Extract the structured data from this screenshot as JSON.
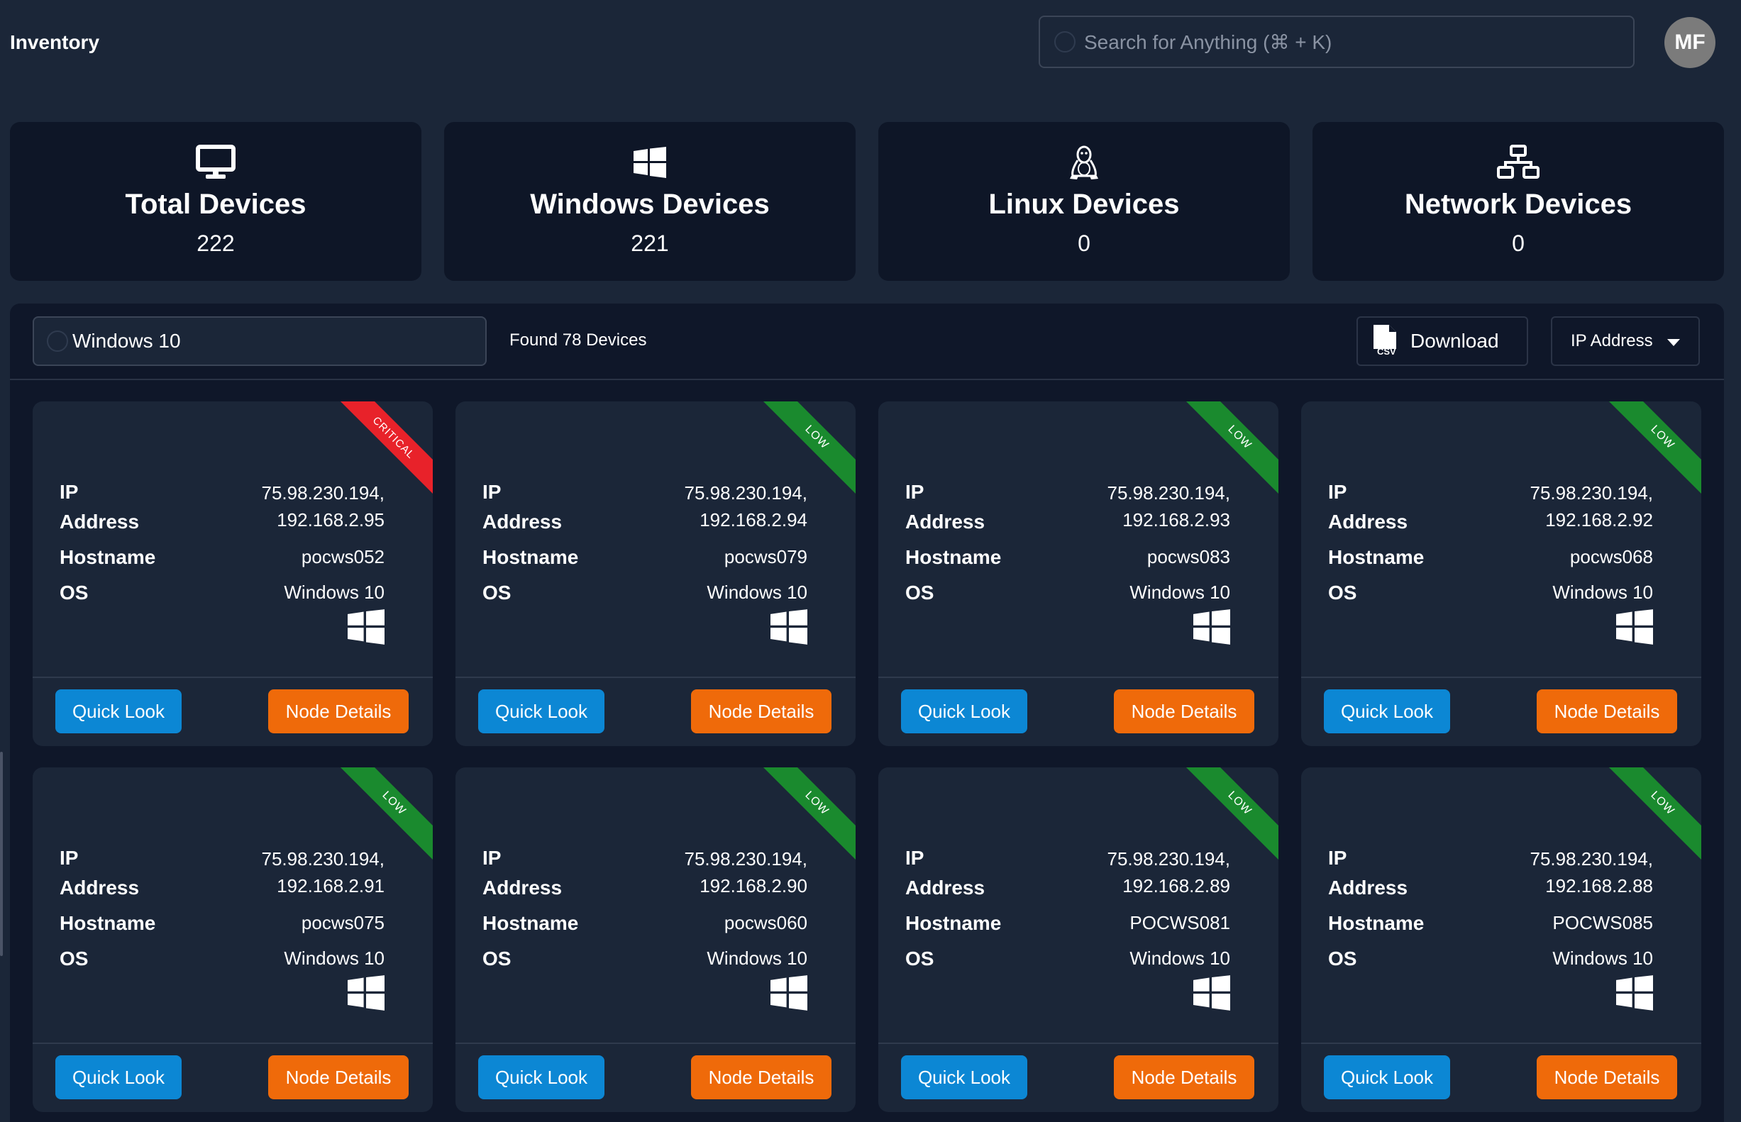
{
  "header": {
    "title": "Inventory",
    "search_placeholder": "Search for Anything (⌘ + K)",
    "avatar_initials": "MF"
  },
  "stats": [
    {
      "title": "Total Devices",
      "value": "222",
      "icon": "monitor-icon"
    },
    {
      "title": "Windows Devices",
      "value": "221",
      "icon": "windows-icon"
    },
    {
      "title": "Linux Devices",
      "value": "0",
      "icon": "linux-penguin-icon"
    },
    {
      "title": "Network Devices",
      "value": "0",
      "icon": "network-icon"
    }
  ],
  "toolbar": {
    "filter_value": "Windows 10",
    "found_text": "Found 78 Devices",
    "download_label": "Download",
    "sort_label": "IP Address"
  },
  "labels": {
    "ip_line1": "IP",
    "ip_line2": "Address",
    "hostname": "Hostname",
    "os": "OS",
    "quick_look": "Quick Look",
    "node_details": "Node Details"
  },
  "devices": [
    {
      "severity": "CRITICAL",
      "ip_public": "75.98.230.194,",
      "ip_private": "192.168.2.95",
      "hostname": "pocws052",
      "os": "Windows 10"
    },
    {
      "severity": "LOW",
      "ip_public": "75.98.230.194,",
      "ip_private": "192.168.2.94",
      "hostname": "pocws079",
      "os": "Windows 10"
    },
    {
      "severity": "LOW",
      "ip_public": "75.98.230.194,",
      "ip_private": "192.168.2.93",
      "hostname": "pocws083",
      "os": "Windows 10"
    },
    {
      "severity": "LOW",
      "ip_public": "75.98.230.194,",
      "ip_private": "192.168.2.92",
      "hostname": "pocws068",
      "os": "Windows 10"
    },
    {
      "severity": "LOW",
      "ip_public": "75.98.230.194,",
      "ip_private": "192.168.2.91",
      "hostname": "pocws075",
      "os": "Windows 10"
    },
    {
      "severity": "LOW",
      "ip_public": "75.98.230.194,",
      "ip_private": "192.168.2.90",
      "hostname": "pocws060",
      "os": "Windows 10"
    },
    {
      "severity": "LOW",
      "ip_public": "75.98.230.194,",
      "ip_private": "192.168.2.89",
      "hostname": "POCWS081",
      "os": "Windows 10"
    },
    {
      "severity": "LOW",
      "ip_public": "75.98.230.194,",
      "ip_private": "192.168.2.88",
      "hostname": "POCWS085",
      "os": "Windows 10"
    }
  ],
  "colors": {
    "background": "#1b2638",
    "panel": "#0f1729",
    "quick_look": "#0c87d4",
    "node_details": "#ef6a0a",
    "severity_low": "#1a8a2e",
    "severity_critical": "#e8222a"
  }
}
